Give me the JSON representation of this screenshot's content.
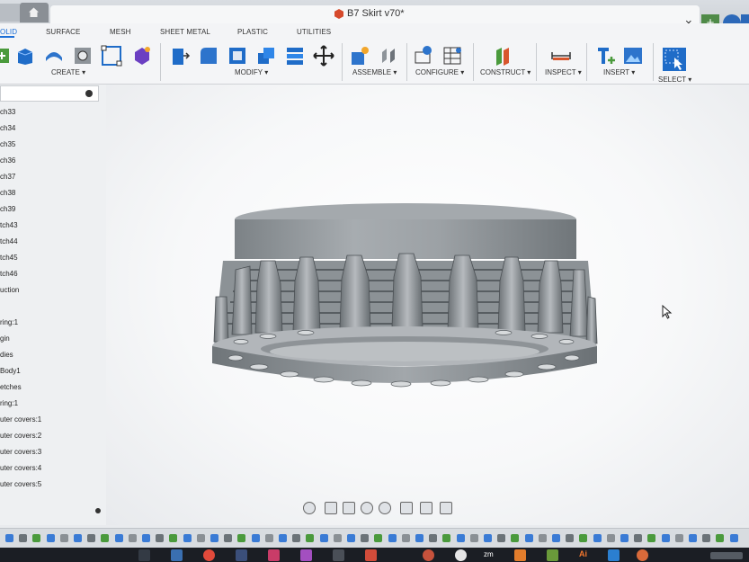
{
  "window": {
    "title": "B7 Skirt v70*",
    "close_glyph": "×",
    "new_tab_glyph": "+"
  },
  "ribbon_tabs": [
    {
      "label": "OLID",
      "active": true
    },
    {
      "label": "SURFACE",
      "active": false
    },
    {
      "label": "MESH",
      "active": false
    },
    {
      "label": "SHEET METAL",
      "active": false
    },
    {
      "label": "PLASTIC",
      "active": false
    },
    {
      "label": "UTILITIES",
      "active": false
    }
  ],
  "ribbon_groups": {
    "create": "CREATE ▾",
    "modify": "MODIFY ▾",
    "assemble": "ASSEMBLE ▾",
    "configure": "CONFIGURE ▾",
    "construct": "CONSTRUCT ▾",
    "inspect": "INSPECT ▾",
    "insert": "INSERT ▾",
    "select": "SELECT ▾"
  },
  "browser": {
    "items": [
      "ch33",
      "ch34",
      "ch35",
      "ch36",
      "ch37",
      "ch38",
      "ch39",
      "tch43",
      "tch44",
      "tch45",
      "tch46",
      "uction",
      "ring:1",
      "gin",
      "dies",
      "Body1",
      "etches",
      "ring:1",
      "uter covers:1",
      "uter covers:2",
      "uter covers:3",
      "uter covers:4",
      "uter covers:5"
    ]
  },
  "colors": {
    "accent": "#1d6fd6",
    "model_gray": "#9a9fa3",
    "taskbar": "#1b1e24"
  },
  "taskbar": {
    "zoom_label": "zm",
    "illustrator_label": "Ai"
  },
  "icons": [
    "home-icon",
    "fusion-doc-icon",
    "orbit-icon",
    "pan-icon",
    "zoom-icon",
    "display-icon",
    "grid-icon"
  ]
}
